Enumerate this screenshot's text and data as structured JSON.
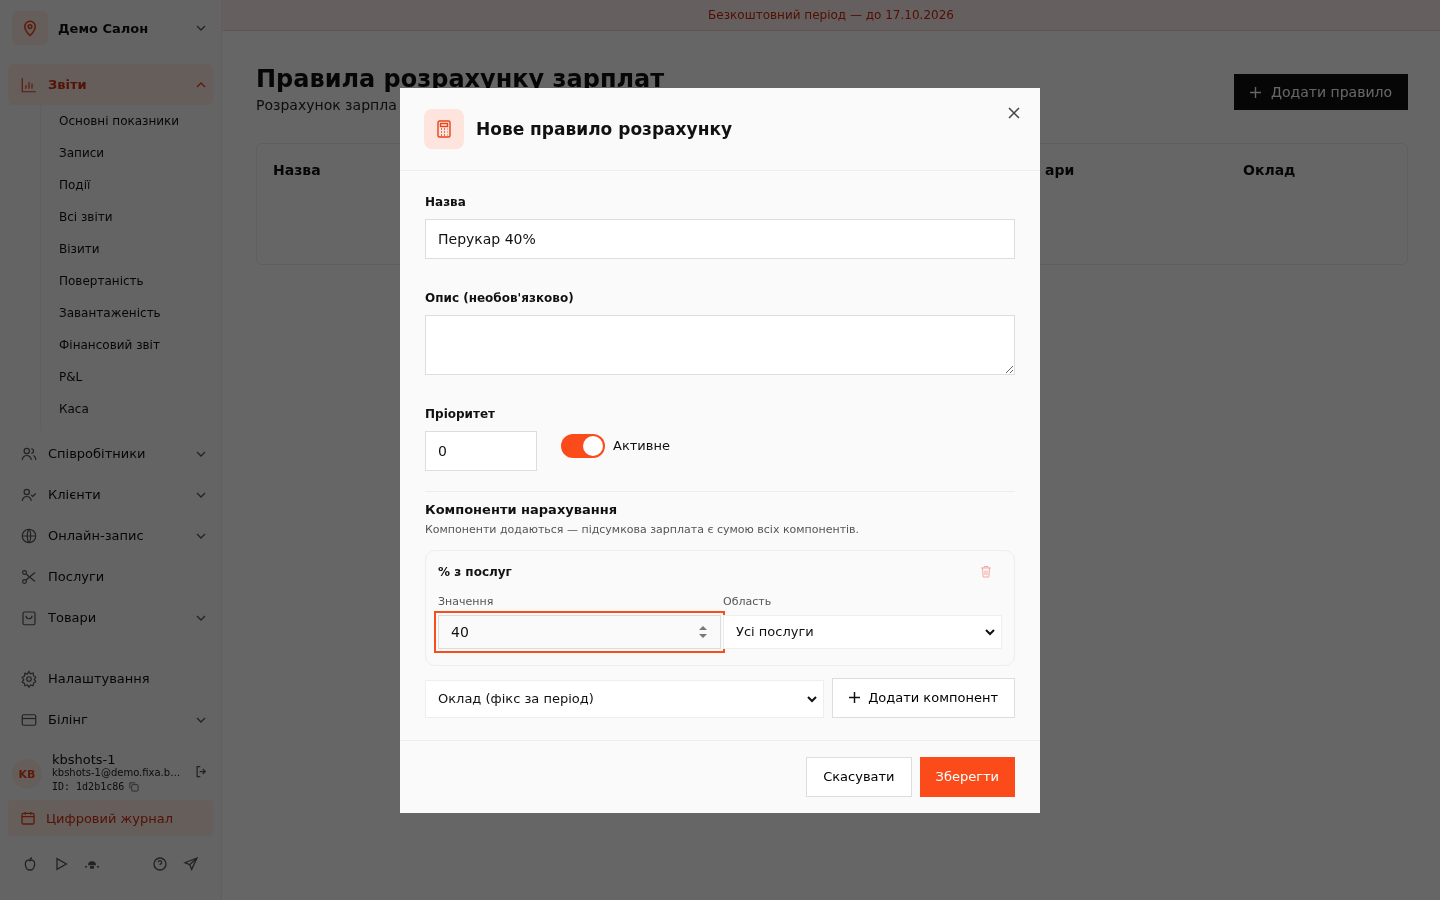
{
  "sidebar": {
    "salon": "Демо Салон",
    "nav": [
      {
        "kind": "group",
        "label": "Звіти",
        "selected": true,
        "expanded": true,
        "children": [
          {
            "label": "Основні показники"
          },
          {
            "label": "Записи"
          },
          {
            "label": "Події"
          },
          {
            "label": "Всі звіти"
          },
          {
            "label": "Візити"
          },
          {
            "label": "Повертаність"
          },
          {
            "label": "Завантаженість"
          },
          {
            "label": "Фінансовий звіт"
          },
          {
            "label": "P&L"
          },
          {
            "label": "Каса"
          }
        ]
      },
      {
        "kind": "group",
        "label": "Співробітники",
        "selected": false,
        "expanded": false
      },
      {
        "kind": "group",
        "label": "Клієнти",
        "selected": false,
        "expanded": false
      },
      {
        "kind": "group",
        "label": "Онлайн-запис",
        "selected": false,
        "expanded": false
      },
      {
        "kind": "link",
        "label": "Послуги",
        "selected": false
      },
      {
        "kind": "group",
        "label": "Товари",
        "selected": false,
        "expanded": false
      },
      {
        "kind": "gap"
      },
      {
        "kind": "link",
        "label": "Налаштування",
        "selected": false
      },
      {
        "kind": "group",
        "label": "Білінг",
        "selected": false,
        "expanded": false
      }
    ],
    "user": {
      "initials": "KB",
      "name": "kbshots-1",
      "email": "kbshots-1@demo.fixa.b…",
      "id": "ID: 1d2b1c86"
    },
    "journal_button": "Цифровий журнал"
  },
  "banner": "Безкоштовний період — до 17.10.2026",
  "page": {
    "title": "Правила розрахунку зарплат",
    "subtitle": "Розрахунок зарпла",
    "add_button": "Додати правило",
    "columns": [
      "Назва",
      "ари",
      "Оклад"
    ]
  },
  "modal": {
    "title": "Нове правило розрахунку",
    "name_label": "Назва",
    "name_value": "Перукар 40%",
    "description_label": "Опис (необов'язково)",
    "priority_label": "Пріоритет",
    "priority_value": "0",
    "active": {
      "label": "Активне",
      "on": true
    },
    "components_title": "Компоненти нарахування",
    "components_hint": "Компоненти додаються — підсумкова зарплата є сумою всіх компонентів.",
    "components": [
      {
        "title": "% з послуг",
        "value_label": "Значення",
        "value": "40",
        "focused": true,
        "scope_label": "Область",
        "scope": "Усі послуги"
      }
    ],
    "new_component_type": "Оклад (фікс за період)",
    "add_component_button": "Додати компонент",
    "cancel_button": "Скасувати",
    "save_button": "Зберегти"
  }
}
